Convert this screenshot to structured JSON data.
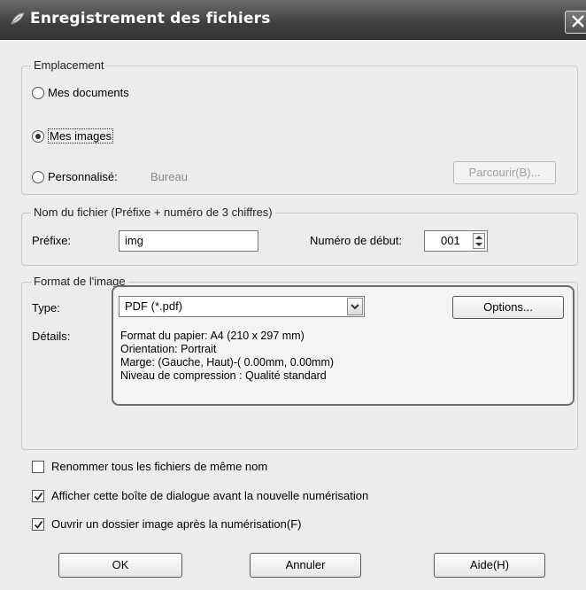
{
  "window": {
    "title": "Enregistrement des fichiers"
  },
  "location": {
    "legend": "Emplacement",
    "options": [
      {
        "label": "Mes documents",
        "selected": false
      },
      {
        "label": "Mes images",
        "selected": true
      },
      {
        "label": "Personnalisé:",
        "selected": false
      }
    ],
    "custom_path": "Bureau",
    "browse_label": "Parcourir(B)..."
  },
  "filename": {
    "legend": "Nom du fichier (Préfixe + numéro de 3 chiffres)",
    "prefix_label": "Préfixe:",
    "prefix_value": "img",
    "start_number_label": "Numéro de début:",
    "start_number_value": "001"
  },
  "image_format": {
    "legend": "Format de l'image",
    "type_label": "Type:",
    "type_value": "PDF (*.pdf)",
    "options_label": "Options...",
    "details_label": "Détails:",
    "details_lines": [
      "Format du papier: A4 (210 x 297 mm)",
      "Orientation: Portrait",
      "Marge: (Gauche, Haut)-( 0.00mm, 0.00mm)",
      "Niveau de compression : Qualité standard"
    ]
  },
  "checkboxes": [
    {
      "label": "Renommer tous les fichiers de même nom",
      "checked": false
    },
    {
      "label": "Afficher cette boîte de dialogue avant la nouvelle numérisation",
      "checked": true
    },
    {
      "label": "Ouvrir un dossier image après la numérisation(F)",
      "checked": true
    }
  ],
  "buttons": {
    "ok": "OK",
    "cancel": "Annuler",
    "help": "Aide(H)"
  },
  "icons": {
    "title": "scanner-leaf-icon",
    "close": "close-icon",
    "spinner": "spinner-icon",
    "dropdown": "chevron-down-icon",
    "check": "check-icon"
  }
}
